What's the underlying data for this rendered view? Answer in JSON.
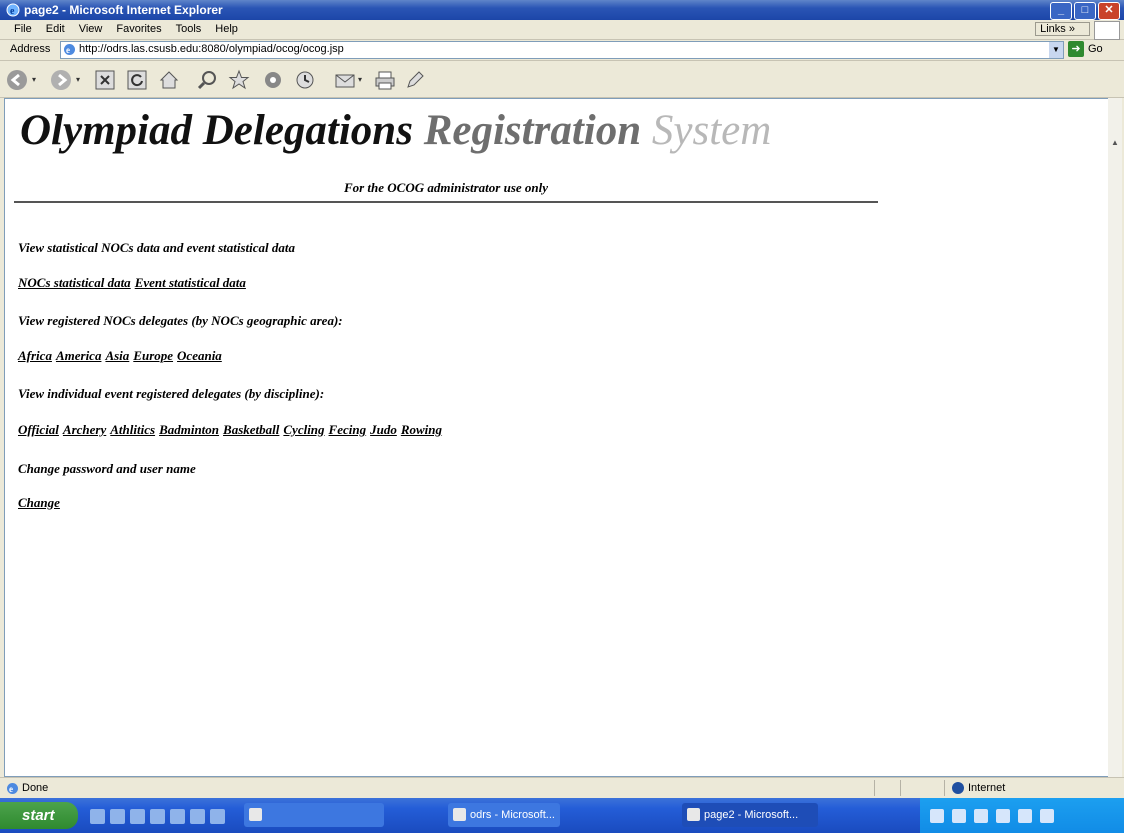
{
  "window": {
    "title": "page2 - Microsoft Internet Explorer"
  },
  "menubar": {
    "items": [
      "File",
      "Edit",
      "View",
      "Favorites",
      "Tools",
      "Help"
    ],
    "links_label": "Links"
  },
  "addressbar": {
    "label": "Address",
    "url": "http://odrs.las.csusb.edu:8080/olympiad/ocog/ocog.jsp",
    "go_label": "Go"
  },
  "toolbar": {
    "buttons": [
      "back-icon",
      "forward-icon",
      "stop-icon",
      "refresh-icon",
      "home-icon",
      "search-icon",
      "favorites-icon",
      "media-icon",
      "history-icon",
      "mail-icon",
      "print-icon",
      "edit-icon"
    ]
  },
  "page": {
    "title_part1": "Olympiad Delegations",
    "title_part2": "Registration",
    "title_part3": "System",
    "subtitle": "For the OCOG administrator use only",
    "sections": [
      {
        "heading": "View statistical NOCs data and event statistical data",
        "links": [
          "NOCs statistical data",
          "Event statistical data"
        ]
      },
      {
        "heading": "View registered NOCs delegates (by NOCs geographic area):",
        "links": [
          "Africa",
          "America",
          "Asia",
          "Europe",
          "Oceania"
        ]
      },
      {
        "heading": "View individual event registered delegates (by discipline):",
        "links": [
          "Official",
          "Archery",
          "Athlitics",
          "Badminton",
          "Basketball",
          "Cycling",
          "Fecing",
          "Judo",
          "Rowing"
        ]
      },
      {
        "heading": "Change password and user name",
        "links": [
          "Change"
        ]
      }
    ]
  },
  "statusbar": {
    "status_text": "Done",
    "zone_text": "Internet"
  },
  "taskbar": {
    "start_label": "start",
    "items": [
      {
        "label": "",
        "active": false
      },
      {
        "label": "odrs - Microsoft...",
        "active": false
      },
      {
        "label": "page2 - Microsoft...",
        "active": true
      }
    ]
  }
}
